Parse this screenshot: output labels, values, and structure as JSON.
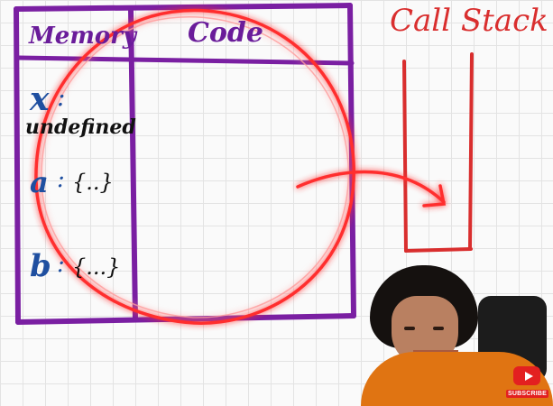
{
  "headings": {
    "memory": "Memory",
    "code": "Code",
    "call_stack": "Call Stack"
  },
  "memory_entries": [
    {
      "name": "x",
      "separator": ":",
      "value": "undefined"
    },
    {
      "name": "a",
      "separator": ":",
      "value": "{..}"
    },
    {
      "name": "b",
      "separator": ":",
      "value": "{...}"
    }
  ],
  "badge": {
    "label": "SUBSCRIBE",
    "icon": "youtube-play-icon"
  },
  "colors": {
    "table_border": "#7a1fa2",
    "memory_names": "#1f4fa0",
    "call_stack": "#d92e2e",
    "highlight_circle": "#ff2a2a"
  }
}
